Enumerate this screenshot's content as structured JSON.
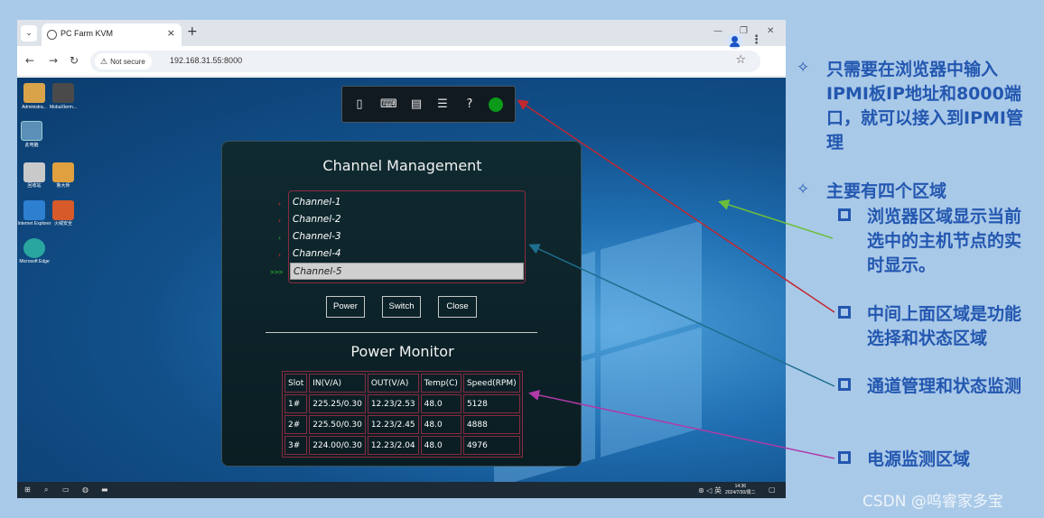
{
  "browser": {
    "tab_title": "PC Farm KVM",
    "tab_close": "×",
    "new_tab": "+",
    "security_label": "Not secure",
    "url": "192.168.31.55:8000",
    "minimize": "—",
    "restore": "❐",
    "close": "✕"
  },
  "kvm_toolbar": {
    "icons": [
      "mouse-icon",
      "keyboard-icon",
      "clipboard-icon",
      "list-icon",
      "help-icon",
      "status-led"
    ],
    "status_color": "#0b9a1a"
  },
  "channel_management": {
    "title": "Channel Management",
    "channels": [
      {
        "label": "Channel-1",
        "marker": "›",
        "marker_color": "#e0302a",
        "selected": false
      },
      {
        "label": "Channel-2",
        "marker": "›",
        "marker_color": "#e0302a",
        "selected": false
      },
      {
        "label": "Channel-3",
        "marker": "›",
        "marker_color": "#2fb12f",
        "selected": false
      },
      {
        "label": "Channel-4",
        "marker": "›",
        "marker_color": "#e0302a",
        "selected": false
      },
      {
        "label": "Channel-5",
        "marker": ">>>",
        "marker_color": "#2fb12f",
        "selected": true
      }
    ],
    "buttons": {
      "power": "Power",
      "switch": "Switch",
      "close": "Close"
    }
  },
  "power_monitor": {
    "title": "Power Monitor",
    "headers": [
      "Slot",
      "IN(V/A)",
      "OUT(V/A)",
      "Temp(C)",
      "Speed(RPM)"
    ],
    "rows": [
      [
        "1#",
        "225.25/0.30",
        "12.23/2.53",
        "48.0",
        "5128"
      ],
      [
        "2#",
        "225.50/0.30",
        "12.23/2.45",
        "48.0",
        "4888"
      ],
      [
        "3#",
        "224.00/0.30",
        "12.23/2.04",
        "48.0",
        "4976"
      ]
    ]
  },
  "taskbar": {
    "clock_time": "14:36",
    "clock_date": "2024/7/30/周二"
  },
  "annotations": {
    "note1": "只需要在浏览器中输入IPMI板IP地址和8000端口，就可以接入到IPMI管理",
    "note2": "主要有四个区域",
    "item1": "浏览器区域显示当前选中的主机节点的实时显示。",
    "item2": "中间上面区域是功能选择和状态区域",
    "item3": "通道管理和状态监测",
    "item4": "电源监测区域"
  },
  "watermark": "CSDN @呜睿家多宝",
  "colors": {
    "accent_text": "#2357b0",
    "arrow_red": "#c0282e",
    "arrow_green": "#6cbf3a",
    "arrow_teal": "#1f6f8f",
    "arrow_magenta": "#b03aa8"
  }
}
